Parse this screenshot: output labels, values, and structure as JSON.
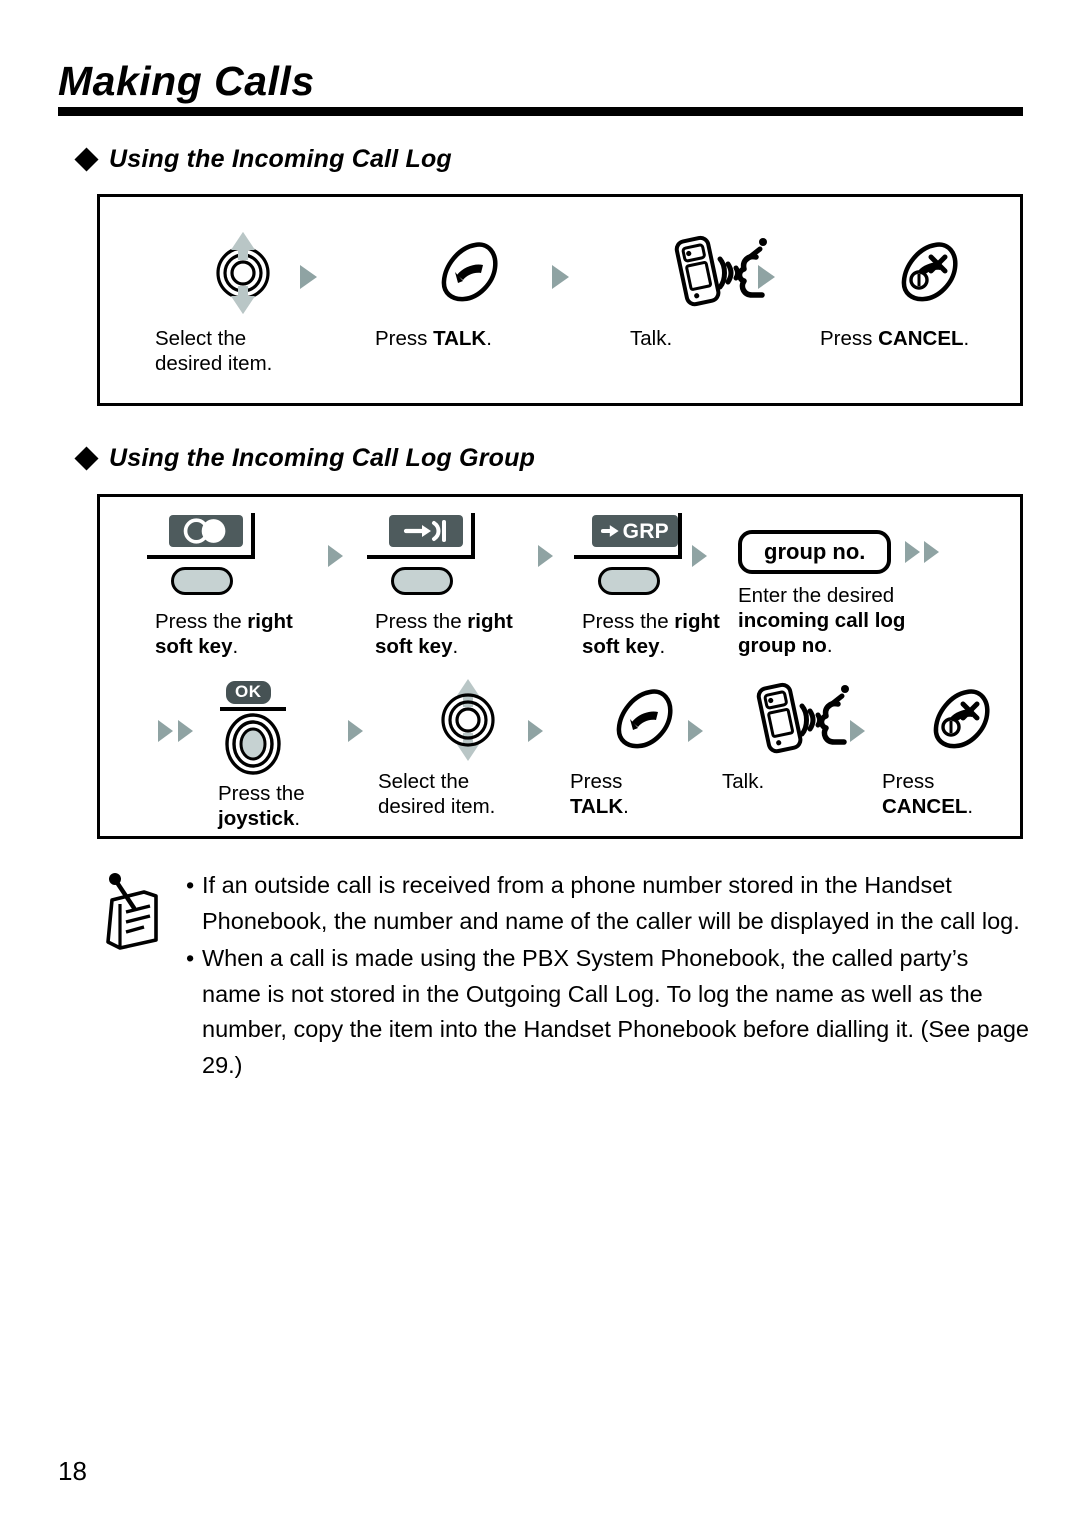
{
  "page": {
    "title": "Making Calls",
    "number": "18"
  },
  "sections": [
    {
      "heading": "Using the Incoming Call Log",
      "rows": [
        {
          "steps": [
            {
              "icon": "joystick-updown-icon",
              "caption": [
                "Select the",
                "desired item."
              ]
            },
            {
              "icon": "talk-key-icon",
              "caption_pre": "Press ",
              "caption_bold": "TALK",
              "caption_post": "."
            },
            {
              "icon": "handset-talking-icon",
              "caption": [
                "Talk."
              ]
            },
            {
              "icon": "cancel-key-icon",
              "caption_pre": "Press ",
              "caption_bold": "CANCEL",
              "caption_post": "."
            }
          ]
        }
      ]
    },
    {
      "heading": "Using the Incoming Call Log Group",
      "rows": [
        {
          "steps": [
            {
              "icon": "softkey-two-circles-icon",
              "caption_pre": "Press the ",
              "caption_bold": "right",
              "caption_line2_bold": "soft key",
              "caption_post": "."
            },
            {
              "icon": "softkey-arrow-in-icon",
              "caption_pre": "Press the ",
              "caption_bold": "right",
              "caption_line2_bold": "soft key",
              "caption_post": "."
            },
            {
              "icon": "softkey-grp-icon",
              "caption_pre": "Press the ",
              "caption_bold": "right",
              "caption_line2_bold": "soft key",
              "caption_post": "."
            },
            {
              "icon": "group-no-entry-box",
              "label": "group no.",
              "caption_line1": "Enter the desired",
              "caption_line2_bold": "incoming call log",
              "caption_line3_bold": "group no",
              "caption_post": "."
            }
          ]
        },
        {
          "steps": [
            {
              "icon": "ok-joystick-icon",
              "label": "OK",
              "caption_pre": "Press the",
              "caption_bold": "joystick",
              "caption_post": "."
            },
            {
              "icon": "joystick-updown-icon",
              "caption": [
                "Select the",
                "desired item."
              ]
            },
            {
              "icon": "talk-key-icon",
              "caption_pre": "Press",
              "caption_bold": "TALK",
              "caption_post": "."
            },
            {
              "icon": "handset-talking-icon",
              "caption": [
                "Talk."
              ]
            },
            {
              "icon": "cancel-key-icon",
              "caption_pre": "Press",
              "caption_bold": "CANCEL",
              "caption_post": "."
            }
          ]
        }
      ]
    }
  ],
  "note": {
    "icon": "notepad-pencil-icon",
    "bullet": "•",
    "items": [
      "If an outside call is received from a phone number stored in the Handset Phonebook, the number and name of the caller will be displayed in the call log.",
      "When a call is made using the PBX System Phonebook, the called party’s name is not stored in the Outgoing Call Log. To log the name as well as the number, copy the item into the Handset Phonebook before dialling it. (See page 29.)"
    ]
  },
  "labels": {
    "select_the": "Select the",
    "desired_item": "desired item.",
    "press": "Press",
    "press_the": "Press the",
    "press_sp": "Press ",
    "press_the_sp": "Press the ",
    "talk_bold": "TALK",
    "talk_plain": "Talk.",
    "cancel_bold": "CANCEL",
    "right": "right",
    "soft_key": "soft key",
    "joystick": "joystick",
    "ok": "OK",
    "grp": "GRP",
    "group_no_box": "group no.",
    "enter_desired": "Enter the desired",
    "incoming_call_log": "incoming call log",
    "group_no": "group no",
    "period": "."
  },
  "colors": {
    "arrow_gray": "#8fa3a3",
    "softkey_dark": "#4e5b5d",
    "softkey_button": "#c6d2d2",
    "joystick_center": "#c6d2d2",
    "ink": "#000000"
  }
}
